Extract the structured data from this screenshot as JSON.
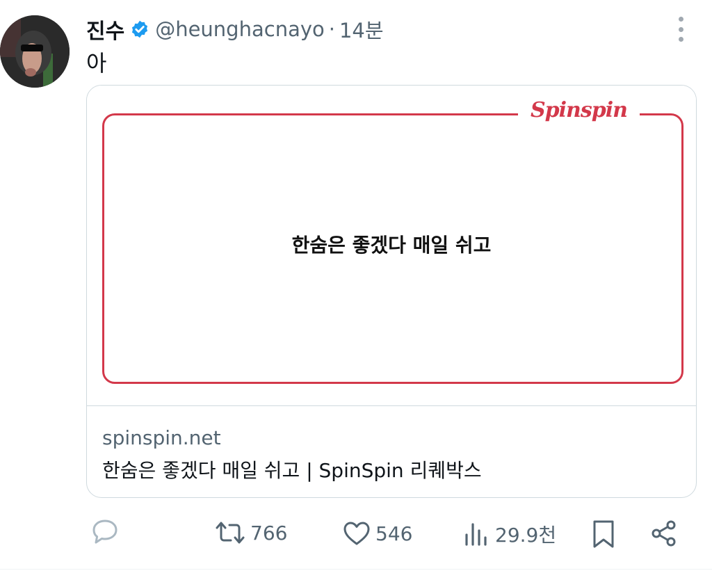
{
  "post": {
    "author_name": "진수",
    "handle": "@heunghacnayo",
    "separator": "·",
    "time": "14분",
    "text": "아",
    "verified_icon": "verified-badge-icon",
    "more_icon": "more-vertical-icon"
  },
  "card": {
    "brand": "Spinspin",
    "phrase": "한숨은 좋겠다 매일 쉬고",
    "domain": "spinspin.net",
    "title": "한숨은 좋겠다 매일 쉬고 | SpinSpin 리퀘박스"
  },
  "actions": {
    "reply": {
      "icon": "reply-icon"
    },
    "repost": {
      "icon": "repost-icon",
      "count": "766"
    },
    "like": {
      "icon": "heart-icon",
      "count": "546"
    },
    "views": {
      "icon": "views-icon",
      "count": "29.9천"
    },
    "bookmark": {
      "icon": "bookmark-icon"
    },
    "share": {
      "icon": "share-icon"
    }
  },
  "colors": {
    "brand_red": "#d3384a",
    "verified_blue": "#1d9bf0",
    "muted_text": "#536471",
    "icon_light": "#aab8c2"
  }
}
